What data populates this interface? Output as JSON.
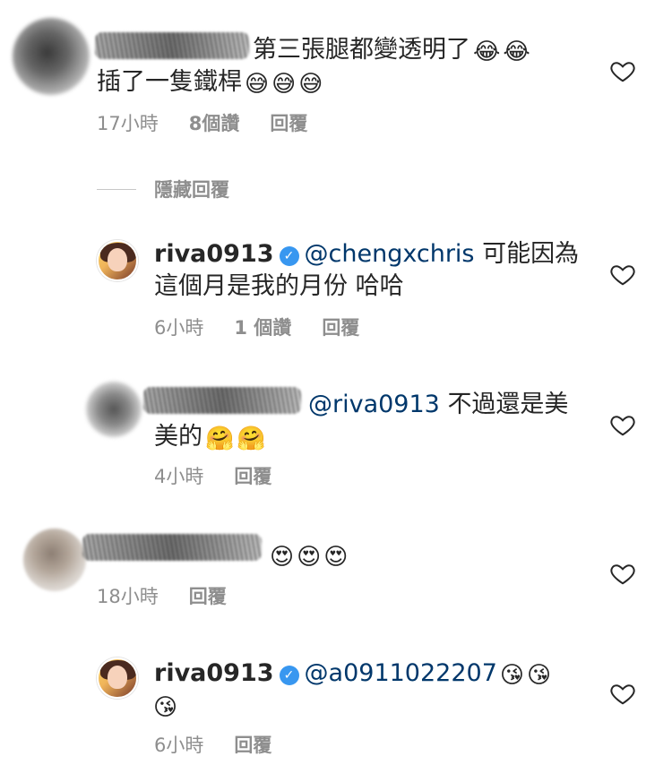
{
  "comments": [
    {
      "text_line1": "第三張腿都變透明了",
      "text_line2": "插了一隻鐵桿",
      "emojis_line1": [
        "😂",
        "😂"
      ],
      "emojis_line2": [
        "😅",
        "😅",
        "😅"
      ],
      "time": "17小時",
      "likes": "8個讚",
      "reply": "回覆"
    }
  ],
  "hidden_replies_label": "隱藏回覆",
  "replies": [
    {
      "username": "riva0913",
      "mention": "@chengxchris",
      "text_line1": "可能因為",
      "text_line2": "這個月是我的月份 哈哈",
      "time": "6小時",
      "likes": "1 個讚",
      "reply": "回覆"
    },
    {
      "mention": "@riva0913",
      "text_line1": "不過還是美",
      "text_line2": "美的",
      "emojis": [
        "🤗",
        "🤗"
      ],
      "time": "4小時",
      "reply": "回覆"
    },
    {
      "emojis": [
        "😍",
        "😍",
        "😍"
      ],
      "time": "18小時",
      "reply": "回覆"
    },
    {
      "username": "riva0913",
      "mention": "@a0911022207",
      "emojis_line1": [
        "😘",
        "😘"
      ],
      "emojis_line2": [
        "😘"
      ],
      "time": "6小時",
      "reply": "回覆"
    }
  ],
  "icons": {
    "heart": "heart-outline-icon",
    "verified": "verified-badge-icon"
  },
  "colors": {
    "text": "#262626",
    "meta": "#8e8e8e",
    "mention": "#00376b",
    "verified": "#3897f0"
  }
}
